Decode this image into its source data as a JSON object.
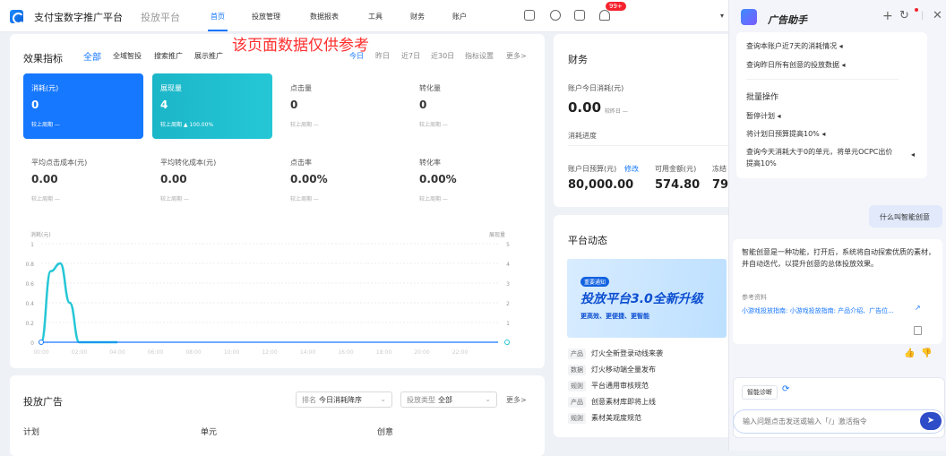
{
  "topbar": {
    "title": "支付宝数字推广平台",
    "subtitle": "投放平台",
    "nav": [
      "首页",
      "投放管理",
      "数据报表",
      "工具",
      "财务",
      "账户"
    ],
    "badge": "99+"
  },
  "watermark": "该页面数据仅供参考",
  "effect": {
    "title": "效果指标",
    "tabs": [
      "全部",
      "全域智投",
      "搜索推广",
      "展示推广"
    ],
    "date_tabs": [
      "今日",
      "昨日",
      "近7日",
      "近30日",
      "指标设置",
      "更多>"
    ],
    "metrics": [
      {
        "label": "消耗(元)",
        "value": "0",
        "compare": "较上周期 —"
      },
      {
        "label": "展现量",
        "value": "4",
        "compare": "较上周期 ▲ 100.00%"
      },
      {
        "label": "点击量",
        "value": "0",
        "compare": "较上周期 —"
      },
      {
        "label": "转化量",
        "value": "0",
        "compare": "较上周期 —"
      },
      {
        "label": "平均点击成本(元)",
        "value": "0.00",
        "compare": "较上周期 —"
      },
      {
        "label": "平均转化成本(元)",
        "value": "0.00",
        "compare": "较上周期 —"
      },
      {
        "label": "点击率",
        "value": "0.00%",
        "compare": "较上周期 —"
      },
      {
        "label": "转化率",
        "value": "0.00%",
        "compare": "较上周期 —"
      }
    ]
  },
  "chart_data": {
    "type": "line",
    "y_left_label": "消耗(元)",
    "y_right_label": "展现量",
    "y_left_ticks": [
      "1",
      "0.8",
      "0.6",
      "0.4",
      "0.2",
      "0"
    ],
    "y_right_ticks": [
      "5",
      "4",
      "3",
      "2",
      "1",
      "0"
    ],
    "ylim_left": [
      0,
      1
    ],
    "ylim_right": [
      0,
      5
    ],
    "categories": [
      "00:00",
      "02:00",
      "04:00",
      "06:00",
      "08:00",
      "10:00",
      "12:00",
      "14:00",
      "16:00",
      "18:00",
      "20:00",
      "22:00"
    ],
    "series": [
      {
        "name": "展现量",
        "axis": "right",
        "color": "#25c7d6",
        "x": [
          0,
          0.5,
          1,
          1.5,
          2,
          2.5,
          3,
          3.5,
          4
        ],
        "values": [
          0,
          3.6,
          4,
          2,
          0,
          0,
          0,
          0,
          0
        ]
      },
      {
        "name": "消耗(元)",
        "axis": "left",
        "color": "#1677ff",
        "x": [
          0,
          24
        ],
        "values": [
          0,
          0
        ]
      }
    ],
    "grid": true
  },
  "ads": {
    "title": "投放广告",
    "sort_prefix": "排名",
    "sort_value": "今日消耗降序",
    "type_prefix": "投放类型",
    "type_value": "全部",
    "more": "更多>",
    "columns": [
      "计划",
      "单元",
      "创意"
    ]
  },
  "finance": {
    "title": "财务",
    "today_label": "账户今日消耗(元)",
    "today_value": "0.00",
    "today_compare": "较昨日 —",
    "progress_label": "消耗进度",
    "budget_label": "账户日预算(元)",
    "budget_edit": "修改",
    "budget_value": "80,000.00",
    "available_label": "可用金额(元)",
    "available_value": "574.80",
    "frozen_label": "冻结",
    "frozen_value": "79,"
  },
  "news": {
    "title": "平台动态",
    "banner_tag": "重要通知",
    "banner_main": "投放平台3.0全新升级",
    "banner_sub": "更高效、更便捷、更智能",
    "items": [
      {
        "tag": "产品",
        "text": "灯火全新登录动线来袭"
      },
      {
        "tag": "数据",
        "text": "灯火移动端全量发布"
      },
      {
        "tag": "规则",
        "text": "平台通用审核规范"
      },
      {
        "tag": "产品",
        "text": "创意素材库即将上线"
      },
      {
        "tag": "规则",
        "text": "素材美观度规范"
      }
    ]
  },
  "assistant": {
    "title": "广告助手",
    "queries": [
      "查询本账户近7天的消耗情况 ◂",
      "查询昨日所有创意的投放数据 ◂"
    ],
    "batch_title": "批量操作",
    "batch_items": [
      "暂停计划 ◂",
      "将计划日预算提高10% ◂",
      "查询今天消耗大于0的单元，将单元OCPC出价提高10%"
    ],
    "user_msg": "什么叫智能创意",
    "answer": "智能创意是一种功能，打开后，系统将自动探索优质的素材，并自动迭代，以提升创意的总体投放效果。",
    "ref_label": "参考资料",
    "ref_link": "小游戏投放指南: 小游戏投放指南: 产品介绍、广告位...",
    "chip": "智能诊断",
    "input_placeholder": "输入问题点击发送或输入「/」激活指令"
  }
}
